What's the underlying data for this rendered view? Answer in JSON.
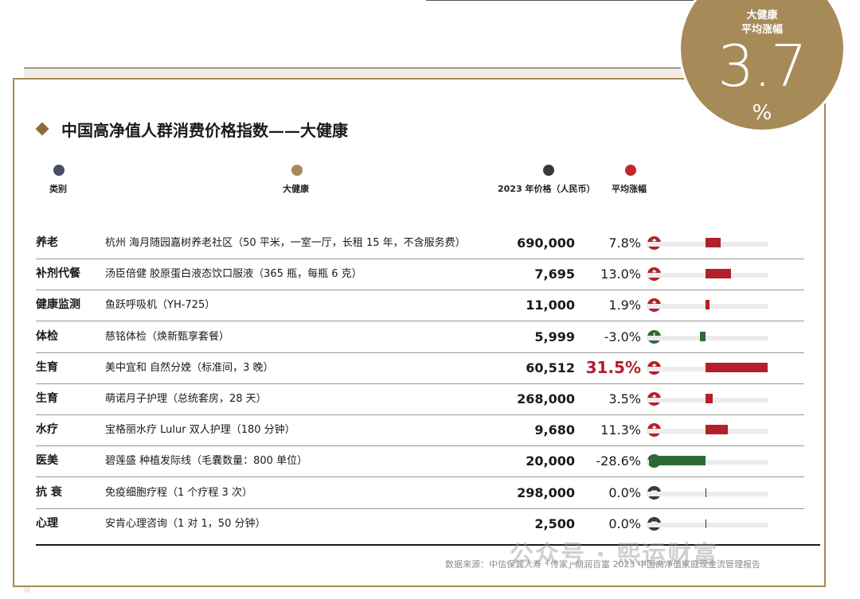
{
  "badge": {
    "label_line1": "大健康",
    "label_line2": "平均涨幅",
    "value": "3.7",
    "unit": "%"
  },
  "title": "中国高净值人群消费价格指数——大健康",
  "legend": [
    {
      "label": "类别",
      "color": "#474e66"
    },
    {
      "label": "大健康",
      "color": "#a68a58"
    },
    {
      "label": "2023 年价格（人民币）",
      "color": "#3a3a3a"
    },
    {
      "label": "平均涨幅",
      "color": "#c1272d"
    }
  ],
  "colors": {
    "up": "#b3202a",
    "down": "#2e6b34",
    "flat": "#3a3a3a",
    "accent": "#a68a58"
  },
  "chart_data": {
    "type": "table",
    "columns": [
      "类别",
      "大健康",
      "2023 年价格（人民币）",
      "平均涨幅"
    ],
    "rows": [
      {
        "category": "养老",
        "item": "杭州 海月随园嘉树养老社区（50 平米，一室一厅，长租 15 年，不含服务费）",
        "price": "690,000",
        "change": 7.8,
        "change_label": "7.8%",
        "direction": "up"
      },
      {
        "category": "补剂代餐",
        "item": "汤臣倍健 胶原蛋白液态饮口服液（365 瓶，每瓶 6 克）",
        "price": "7,695",
        "change": 13.0,
        "change_label": "13.0%",
        "direction": "up"
      },
      {
        "category": "健康监测",
        "item": "鱼跃呼吸机（YH-725）",
        "price": "11,000",
        "change": 1.9,
        "change_label": "1.9%",
        "direction": "up"
      },
      {
        "category": "体检",
        "item": "慈铭体检（焕新甄享套餐）",
        "price": "5,999",
        "change": -3.0,
        "change_label": "-3.0%",
        "direction": "down"
      },
      {
        "category": "生育",
        "item": "美中宜和 自然分娩（标准间，3 晚）",
        "price": "60,512",
        "change": 31.5,
        "change_label": "31.5%",
        "direction": "up",
        "highlight": true
      },
      {
        "category": "生育",
        "item": "萌诺月子护理（总统套房，28 天）",
        "price": "268,000",
        "change": 3.5,
        "change_label": "3.5%",
        "direction": "up"
      },
      {
        "category": "水疗",
        "item": "宝格丽水疗 Lulur 双人护理（180 分钟）",
        "price": "9,680",
        "change": 11.3,
        "change_label": "11.3%",
        "direction": "up"
      },
      {
        "category": "医美",
        "item": "碧莲盛 种植发际线（毛囊数量：800 单位）",
        "price": "20,000",
        "change": -28.6,
        "change_label": "-28.6%",
        "direction": "down"
      },
      {
        "category": "抗 衰",
        "item": "免疫细胞疗程（1 个疗程 3 次）",
        "price": "298,000",
        "change": 0.0,
        "change_label": "0.0%",
        "direction": "flat"
      },
      {
        "category": "心理",
        "item": "安肯心理咨询（1 对 1，50 分钟）",
        "price": "2,500",
        "change": 0.0,
        "change_label": "0.0%",
        "direction": "flat"
      }
    ],
    "bar_range": [
      -30,
      32
    ]
  },
  "source": "数据来源：中信保诚人寿「传家」·胡润百富 2023 中国高净值家庭现金流管理报告",
  "watermark": "公众号 · 熙运财富"
}
